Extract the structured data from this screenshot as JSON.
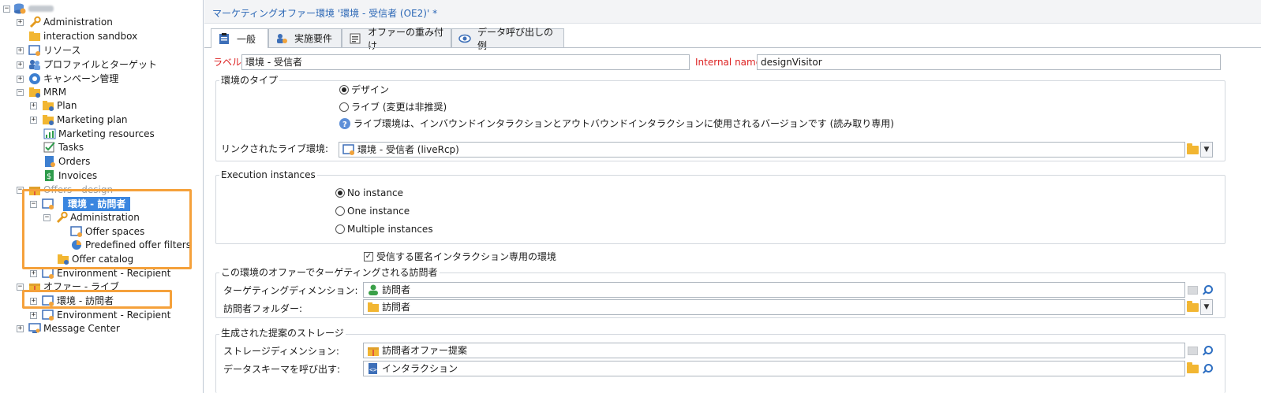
{
  "tree": {
    "nodes": [
      {
        "label": "Administration"
      },
      {
        "label": "interaction sandbox"
      },
      {
        "label": "リソース"
      },
      {
        "label": "プロファイルとターゲット"
      },
      {
        "label": "キャンペーン管理"
      },
      {
        "label": "MRM"
      },
      {
        "label": "Plan"
      },
      {
        "label": "Marketing plan"
      },
      {
        "label": "Marketing resources"
      },
      {
        "label": "Tasks"
      },
      {
        "label": "Orders"
      },
      {
        "label": "Invoices"
      },
      {
        "label": "Offers - design"
      },
      {
        "label": "環境 - 訪問者"
      },
      {
        "label": "Administration"
      },
      {
        "label": "Offer spaces"
      },
      {
        "label": "Predefined offer filters"
      },
      {
        "label": "Offer catalog"
      },
      {
        "label": "Environment - Recipient"
      },
      {
        "label": "オファー - ライブ"
      },
      {
        "label": "環境 - 訪問者"
      },
      {
        "label": "Environment - Recipient"
      },
      {
        "label": "Message Center"
      }
    ]
  },
  "header": {
    "title": "マーケティングオファー環境 '環境 - 受信者 (OE2)' *"
  },
  "tabs": [
    {
      "label": "一般"
    },
    {
      "label": "実施要件"
    },
    {
      "label": "オファーの重み付け"
    },
    {
      "label": "データ呼び出しの例"
    }
  ],
  "form": {
    "label_caption": "ラベル:",
    "label_value": "環境 - 受信者",
    "internal_caption": "Internal name:",
    "internal_value": "designVisitor",
    "env_type_group": "環境のタイプ",
    "radio_design": "デザイン",
    "radio_live": "ライブ (変更は非推奨)",
    "help_text": "ライブ環境は、インバウンドインタラクションとアウトバウンドインタラクションに使用されるバージョンです (読み取り専用)",
    "linked_caption": "リンクされたライブ環境:",
    "linked_value": "環境 - 受信者 (liveRcp)",
    "exec_group": "Execution instances",
    "exec_options": [
      "No instance",
      "One instance",
      "Multiple instances"
    ],
    "anon_checkbox": "受信する匿名インタラクション専用の環境",
    "targeted_group": "この環境のオファーでターゲティングされる訪問者",
    "targeting_caption": "ターゲティングディメンション:",
    "targeting_value": "訪問者",
    "visitor_folder_caption": "訪問者フォルダー:",
    "visitor_folder_value": "訪問者",
    "storage_group": "生成された提案のストレージ",
    "storage_caption": "ストレージディメンション:",
    "storage_value": "訪問者オファー提案",
    "schema_caption": "データスキーマを呼び出す:",
    "schema_value": "インタラクション"
  },
  "colors": {
    "accent": "#3a86e0",
    "highlight": "#f5a13b",
    "title": "#2a66b5",
    "required": "#dd2222"
  }
}
